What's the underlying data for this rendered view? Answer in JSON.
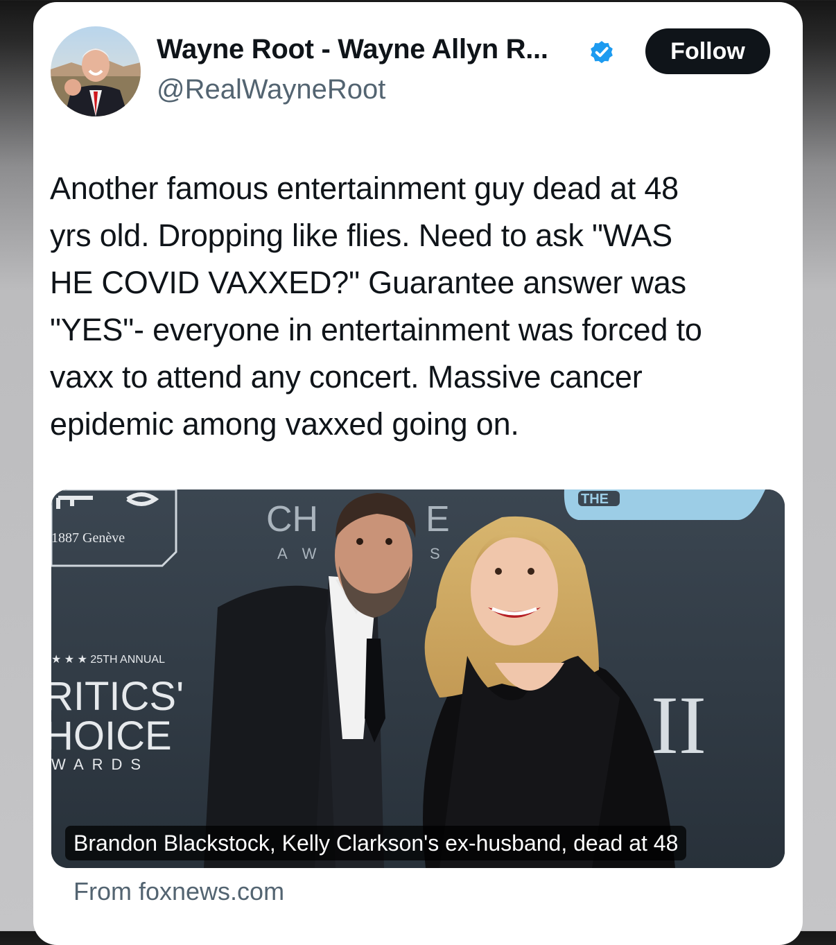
{
  "tweet": {
    "author": {
      "display_name": "Wayne Root - Wayne Allyn R...",
      "handle": "@RealWayneRoot",
      "verified_icon": "verified-badge-icon",
      "avatar_icon": "profile-photo"
    },
    "follow_label": "Follow",
    "text_lines": [
      "Another famous entertainment guy dead at 48",
      "yrs old. Dropping like flies. Need to ask \"WAS",
      "HE COVID VAXXED?\" Guarantee answer was",
      "\"YES\"- everyone in entertainment was forced to",
      "vaxx to attend any concert. Massive cancer",
      "epidemic among vaxxed going on."
    ],
    "link_card": {
      "caption": "Brandon Blackstock, Kelly Clarkson's ex-husband, dead at 48",
      "source": "From foxnews.com"
    }
  },
  "colors": {
    "text_primary": "#0f1419",
    "text_secondary": "#536471",
    "verified_blue": "#1d9bf0",
    "follow_bg": "#0f1419"
  }
}
